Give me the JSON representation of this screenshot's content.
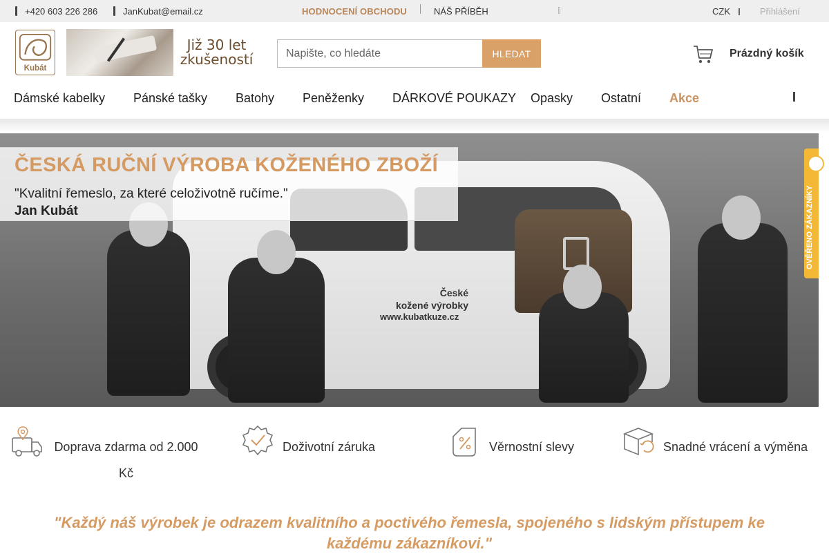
{
  "topbar": {
    "phone": "+420 603 226 286",
    "email": "JanKubat@email.cz",
    "rating_link": "HODNOCENÍ OBCHODU",
    "story_link": "NÁŠ PŘÍBĚH",
    "currency": "CZK",
    "login": "Přihlášení"
  },
  "header": {
    "logo_text": "Kubát",
    "banner_line1": "Již 30 let",
    "banner_line2": "zkušeností",
    "search_placeholder": "Napište, co hledáte",
    "search_button": "HLEDAT",
    "cart_label": "Prázdný košík"
  },
  "nav": {
    "items": [
      "Dámské kabelky",
      "Pánské tašky",
      "Batohy",
      "Peněženky",
      "DÁRKOVÉ POUKAZY",
      "Opasky",
      "Ostatní",
      "Akce"
    ]
  },
  "hero": {
    "title": "ČESKÁ RUČNÍ VÝROBA KOŽENÉHO ZBOŽÍ",
    "quote": "\"Kvalitní řemeslo, za které celoživotně ručíme.\"",
    "author": "Jan Kubát",
    "van_text_1": "České",
    "van_text_2": "kožené výrobky",
    "van_url": "www.kubatkuze.cz"
  },
  "badge": {
    "text": "OVĚŘENO ZÁKAZNÍKY"
  },
  "benefits": [
    {
      "label": "Doprava zdarma od 2.000 Kč",
      "icon": "delivery-van-icon"
    },
    {
      "label": "Doživotní záruka",
      "icon": "warranty-badge-icon"
    },
    {
      "label": "Věrnostní slevy",
      "icon": "discount-tag-icon"
    },
    {
      "label": "Snadné vrácení a výměna",
      "icon": "return-box-icon"
    }
  ],
  "motto": "\"Každý náš výrobek je odrazem kvalitního a poctivého řemesla, spojeného s lidským přístupem ke každému zákazníkovi.\"",
  "colors": {
    "accent": "#d49a62",
    "button": "#d9a068",
    "badge": "#f3b835"
  }
}
